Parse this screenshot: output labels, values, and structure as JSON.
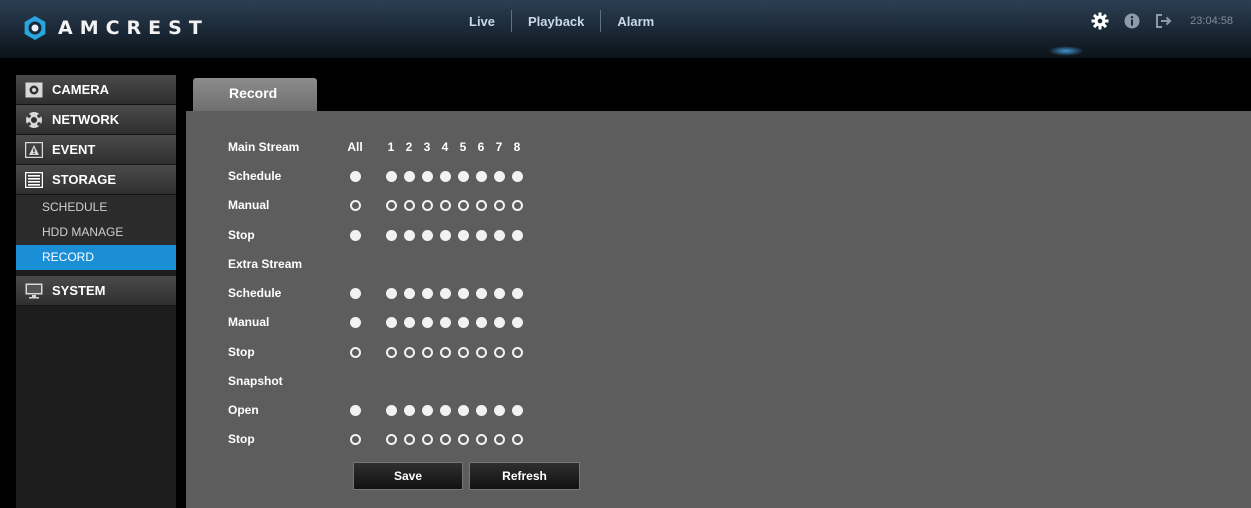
{
  "brand": {
    "name": "AMCREST"
  },
  "nav": {
    "items": [
      "Live",
      "Playback",
      "Alarm"
    ]
  },
  "header": {
    "clock": "23:04:58"
  },
  "sidebar": {
    "camera": "CAMERA",
    "network": "NETWORK",
    "event": "EVENT",
    "storage": "STORAGE",
    "storage_subs": [
      "SCHEDULE",
      "HDD MANAGE",
      "RECORD"
    ],
    "system": "SYSTEM"
  },
  "tab": {
    "label": "Record"
  },
  "record": {
    "columns": {
      "all": "All",
      "channels": [
        "1",
        "2",
        "3",
        "4",
        "5",
        "6",
        "7",
        "8"
      ]
    },
    "main_stream": {
      "title": "Main Stream",
      "schedule": {
        "label": "Schedule",
        "selected": true
      },
      "manual": {
        "label": "Manual",
        "selected": false
      },
      "stop": {
        "label": "Stop",
        "selected": true
      }
    },
    "extra_stream": {
      "title": "Extra Stream",
      "schedule": {
        "label": "Schedule",
        "selected": true
      },
      "manual": {
        "label": "Manual",
        "selected": true
      },
      "stop": {
        "label": "Stop",
        "selected": false
      }
    },
    "snapshot": {
      "title": "Snapshot",
      "open": {
        "label": "Open",
        "selected": true
      },
      "stop": {
        "label": "Stop",
        "selected": false
      }
    }
  },
  "buttons": {
    "save": "Save",
    "refresh": "Refresh"
  },
  "colors": {
    "accent": "#1b8fd6",
    "panel": "#5d5d5d"
  }
}
